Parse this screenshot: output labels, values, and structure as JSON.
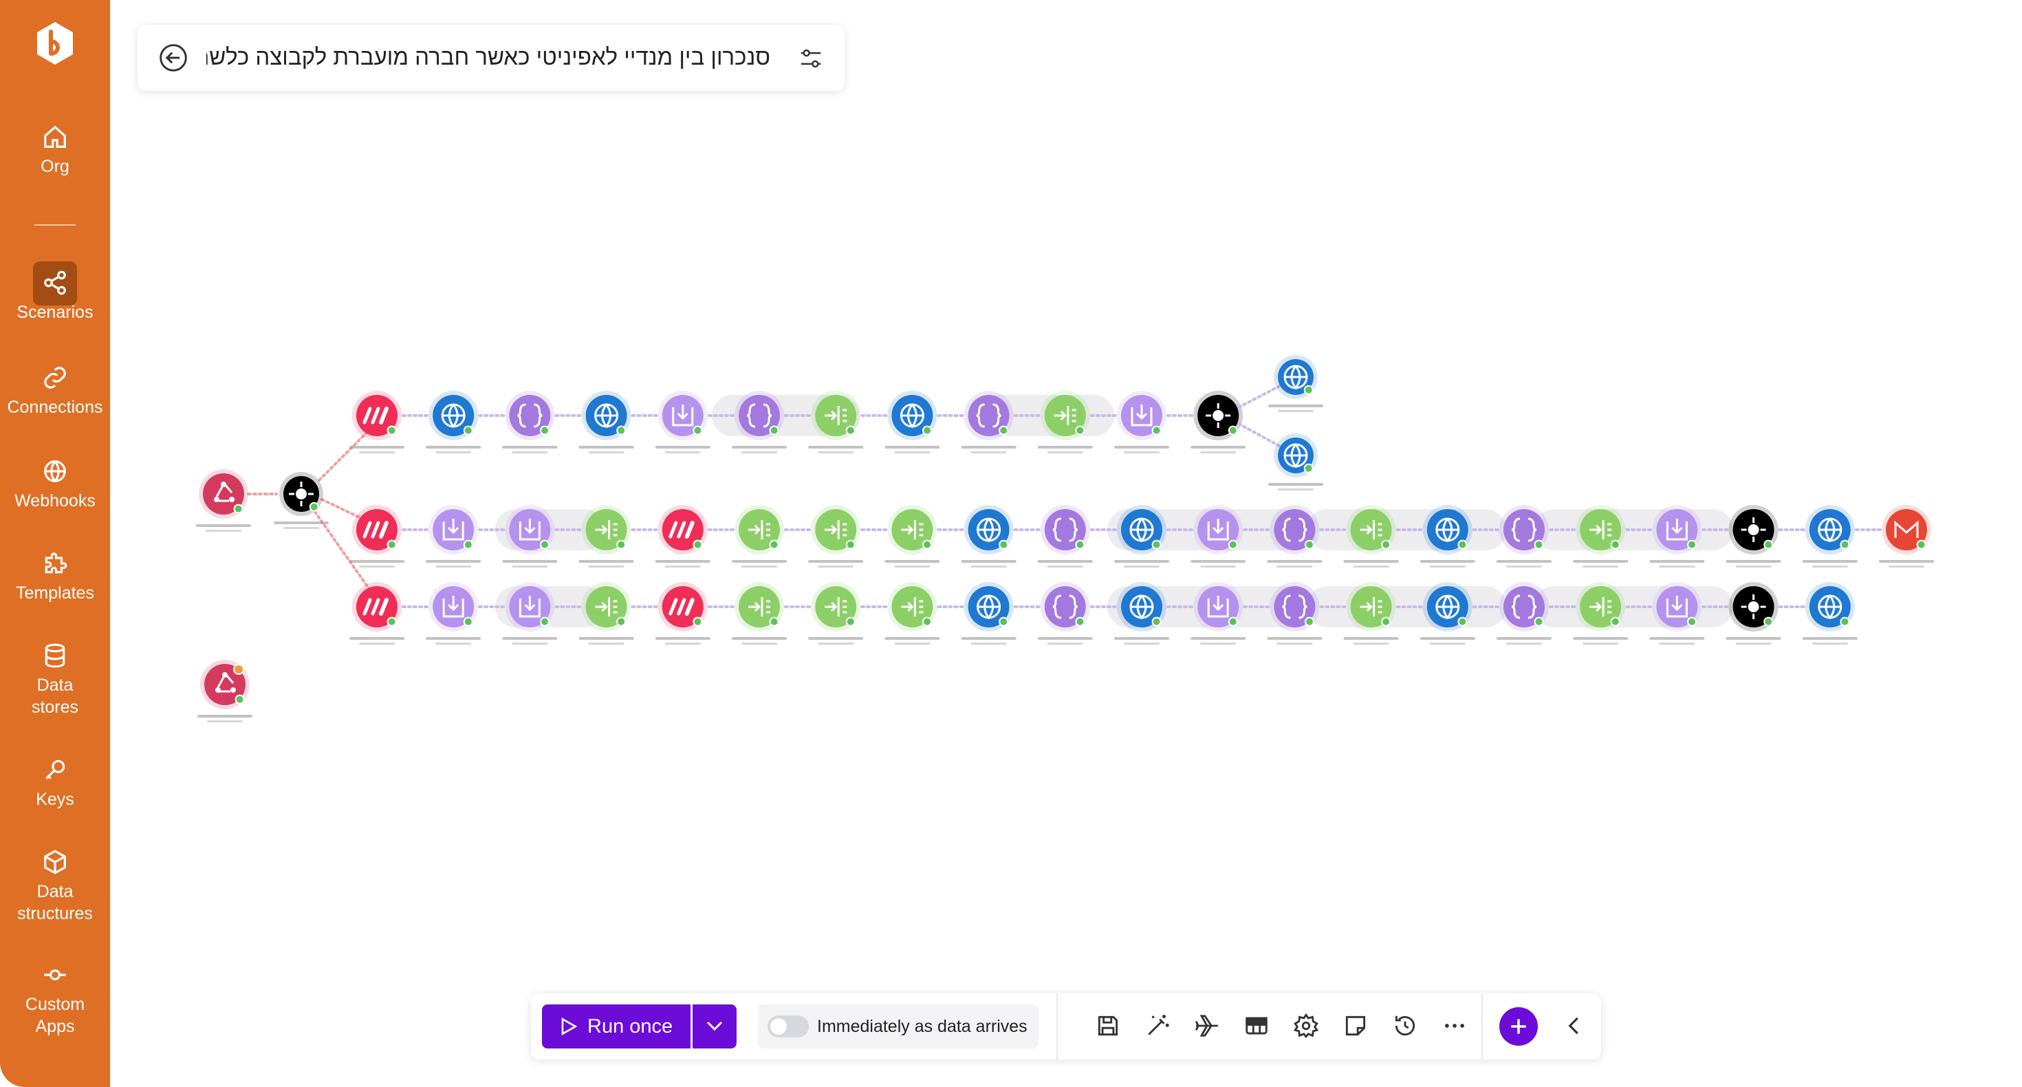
{
  "sidebar": {
    "items": [
      {
        "label": "Org",
        "icon": "home-icon"
      },
      {
        "label": "Scenarios",
        "icon": "share-icon"
      },
      {
        "label": "Connections",
        "icon": "link-icon"
      },
      {
        "label": "Webhooks",
        "icon": "globe-icon"
      },
      {
        "label": "Templates",
        "icon": "puzzle-icon"
      },
      {
        "label": "Data stores",
        "icon": "database-icon"
      },
      {
        "label": "Keys",
        "icon": "key-icon"
      },
      {
        "label": "Data structures",
        "icon": "cube-icon"
      },
      {
        "label": "Custom Apps",
        "icon": "commit-icon"
      }
    ],
    "active": "Scenarios",
    "accent": "#df6f24"
  },
  "scenario": {
    "title": "סנכרון בין מנדיי לאפיניטי כאשר חברה מועברת לקבוצה כלשהי"
  },
  "toolbar": {
    "run_label": "Run once",
    "schedule_label": "Immediately as data arrives",
    "schedule_on": false,
    "icons": [
      "save-icon",
      "magic-wand-icon",
      "airplane-icon",
      "table-icon",
      "gear-icon",
      "note-icon",
      "history-icon",
      "more-icon"
    ],
    "accent": "#6b0cd8"
  },
  "colors": {
    "webhook": "#d43a5e",
    "monday": "#ef2d56",
    "http": "#1f78d1",
    "json": "#a379e0",
    "tools": "#b592ee",
    "flow": "#8ccf67",
    "gmail": "#e74535"
  },
  "flow": {
    "row1": [
      "webhook",
      "router"
    ],
    "branch_top": [
      "monday",
      "http",
      "json",
      "http",
      "tools",
      "json",
      "flow",
      "http",
      "json",
      "flow",
      "tools",
      "router"
    ],
    "branch_top_ends": [
      "http",
      "http"
    ],
    "branch_mid": [
      "monday",
      "tools",
      "tools",
      "flow",
      "monday",
      "flow",
      "flow",
      "flow",
      "http",
      "json",
      "http",
      "tools",
      "json",
      "flow",
      "http",
      "json",
      "flow",
      "tools",
      "router",
      "http",
      "gmail"
    ],
    "branch_bot": [
      "monday",
      "tools",
      "tools",
      "flow",
      "monday",
      "flow",
      "flow",
      "flow",
      "http",
      "json",
      "http",
      "tools",
      "json",
      "flow",
      "http",
      "json",
      "flow",
      "tools",
      "router",
      "http"
    ],
    "standalone": [
      "webhook"
    ]
  }
}
